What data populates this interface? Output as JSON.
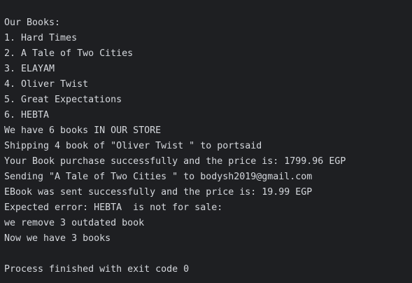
{
  "console": {
    "lines": [
      "Our Books:",
      "1. Hard Times",
      "2. A Tale of Two Cities",
      "3. ELAYAM",
      "4. Oliver Twist",
      "5. Great Expectations",
      "6. HEBTA",
      "We have 6 books IN OUR STORE",
      "Shipping 4 book of \"Oliver Twist \" to portsaid",
      "Your Book purchase successfully and the price is: 1799.96 EGP",
      "Sending \"A Tale of Two Cities \" to bodysh2019@gmail.com",
      "EBook was sent successfully and the price is: 19.99 EGP",
      "Expected error: HEBTA  is not for sale:",
      "we remove 3 outdated book",
      "Now we have 3 books",
      "",
      "Process finished with exit code 0"
    ]
  }
}
